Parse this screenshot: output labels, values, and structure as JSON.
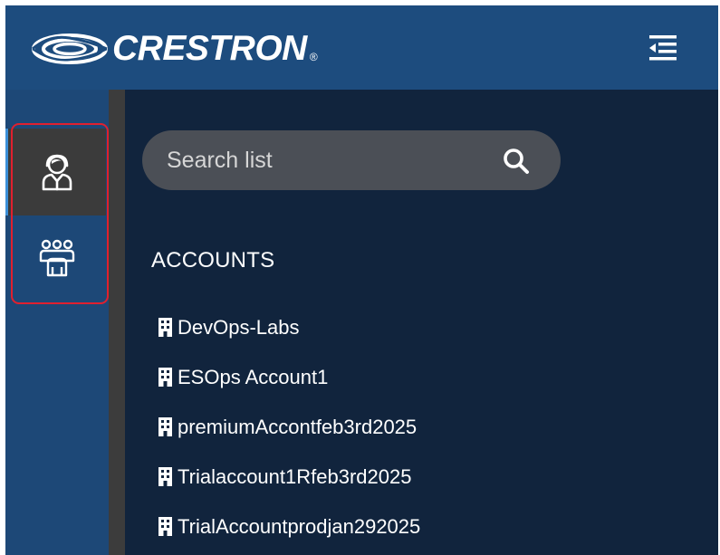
{
  "header": {
    "brand": "CRESTRON",
    "brand_mark": "®",
    "icons": {
      "logo": "crestron-swirl-logo",
      "menu": "collapse-menu-icon"
    }
  },
  "sidebar": {
    "items": [
      {
        "icon": "user-account-icon",
        "active": true
      },
      {
        "icon": "group-users-icon",
        "active": false
      }
    ],
    "highlight_color": "#e0202e"
  },
  "search": {
    "placeholder": "Search list",
    "value": ""
  },
  "accounts": {
    "title": "ACCOUNTS",
    "items": [
      {
        "label": "DevOps-Labs"
      },
      {
        "label": "ESOps Account1"
      },
      {
        "label": "premiumAccontfeb3rd2025"
      },
      {
        "label": "Trialaccount1Rfeb3rd2025"
      },
      {
        "label": "TrialAccountprodjan292025"
      }
    ]
  },
  "colors": {
    "header_bg": "#1d4c7e",
    "content_bg": "#11243d",
    "active_item_bg": "#3b3b3b",
    "accent": "#3a8fd8"
  }
}
